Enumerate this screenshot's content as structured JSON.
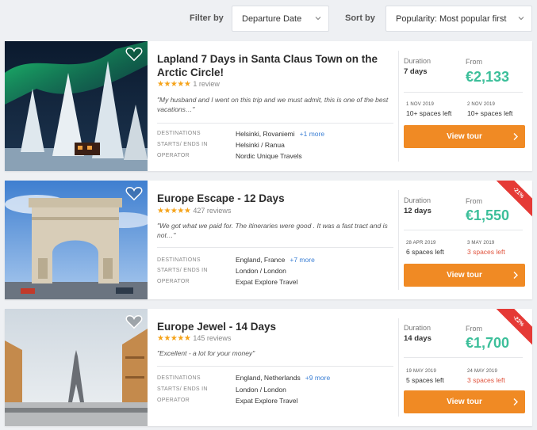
{
  "filters": {
    "filter_label": "Filter by",
    "filter_value": "Departure Date",
    "sort_label": "Sort by",
    "sort_value": "Popularity: Most popular first"
  },
  "labels": {
    "destinations": "DESTINATIONS",
    "starts_ends": "STARTS/ ENDS IN",
    "operator": "OPERATOR",
    "duration": "Duration",
    "from": "From",
    "view_tour": "View tour"
  },
  "tours": [
    {
      "title": "Lapland 7 Days in Santa Claus Town on the Arctic Circle!",
      "rating_stars": "★★★★★",
      "reviews": "1 review",
      "quote": "\"My husband and I went on this trip and we must admit, this is one of the best vacations…\"",
      "destinations": "Helsinki, Rovaniemi",
      "destinations_more": "+1 more",
      "starts_ends": "Helsinki / Ranua",
      "operator": "Nordic Unique Travels",
      "duration": "7 days",
      "price": "€2,133",
      "date1": "1 NOV 2019",
      "spaces1": "10+ spaces left",
      "date2": "2 NOV 2019",
      "spaces2": "10+ spaces left",
      "discount": ""
    },
    {
      "title": "Europe Escape - 12 Days",
      "rating_stars": "★★★★★",
      "reviews": "427 reviews",
      "quote": "\"We got what we paid for. The itineraries were good . It was a fast tract and is not…\"",
      "destinations": "England, France",
      "destinations_more": "+7 more",
      "starts_ends": "London / London",
      "operator": "Expat Explore Travel",
      "duration": "12 days",
      "price": "€1,550",
      "date1": "28 APR 2019",
      "spaces1": "6 spaces left",
      "date2": "3 MAY 2019",
      "spaces2": "3 spaces left",
      "discount": "-21%"
    },
    {
      "title": "Europe Jewel - 14 Days",
      "rating_stars": "★★★★★",
      "reviews": "145 reviews",
      "quote": "\"Excellent - a lot for your money\"",
      "destinations": "England, Netherlands",
      "destinations_more": "+9 more",
      "starts_ends": "London / London",
      "operator": "Expat Explore Travel",
      "duration": "14 days",
      "price": "€1,700",
      "date1": "19 MAY 2019",
      "spaces1": "5 spaces left",
      "date2": "24 MAY 2019",
      "spaces2": "3 spaces left",
      "discount": "-22%"
    }
  ],
  "colors": {
    "accent": "#f08a24",
    "price": "#3cbf9a",
    "discount": "#e53a36",
    "link": "#3b7fd4"
  }
}
